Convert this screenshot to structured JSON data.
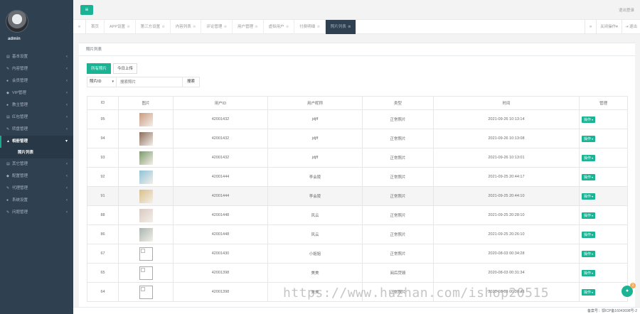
{
  "sidebar": {
    "username": "admin",
    "items": [
      {
        "icon": "▤",
        "label": "基本设置",
        "active": false
      },
      {
        "icon": "✎",
        "label": "内容管理",
        "active": false
      },
      {
        "icon": "●",
        "label": "会员管理",
        "active": false
      },
      {
        "icon": "◆",
        "label": "VIP管理",
        "active": false
      },
      {
        "icon": "●",
        "label": "教主管理",
        "active": false
      },
      {
        "icon": "▤",
        "label": "红包管理",
        "active": false
      },
      {
        "icon": "✎",
        "label": "转盘管理",
        "active": false
      },
      {
        "icon": "▲",
        "label": "相册管理",
        "active": true
      }
    ],
    "submenu_label": "照片列表",
    "items_after": [
      {
        "icon": "▤",
        "label": "其它管理"
      },
      {
        "icon": "◆",
        "label": "配置管理"
      },
      {
        "icon": "✎",
        "label": "代理管理"
      },
      {
        "icon": "●",
        "label": "系统设置"
      },
      {
        "icon": "✎",
        "label": "问题管理"
      }
    ]
  },
  "topbar": {
    "menu_icon": "≡",
    "right_text": "退出登录"
  },
  "tabs": {
    "items": [
      {
        "label": "首页",
        "closable": false,
        "active": false
      },
      {
        "label": "APP设置",
        "closable": true,
        "active": false
      },
      {
        "label": "第三方设置",
        "closable": true,
        "active": false
      },
      {
        "label": "内容列表",
        "closable": true,
        "active": false
      },
      {
        "label": "评论管理",
        "closable": true,
        "active": false
      },
      {
        "label": "用户管理",
        "closable": true,
        "active": false
      },
      {
        "label": "虚拟用户",
        "closable": true,
        "active": false
      },
      {
        "label": "付费明细",
        "closable": true,
        "active": false
      },
      {
        "label": "照片列表",
        "closable": true,
        "active": true
      }
    ],
    "close_ops": "关闭操作",
    "exit": "退出"
  },
  "panel": {
    "title": "照片列表",
    "filter_all": "所有照片",
    "filter_today": "今日上传",
    "select_value": "照片ID",
    "search_placeholder": "搜索照片",
    "search_button": "搜索"
  },
  "table": {
    "headers": [
      "ID",
      "图片",
      "用户ID",
      "用户昵称",
      "类型",
      "时间",
      "管理"
    ],
    "op_label": "操作",
    "rows": [
      {
        "id": "95",
        "thumb": "#c99a7e",
        "user_id": "42001432",
        "nickname": "jdjff",
        "type": "正常照片",
        "time": "2021-09-26 10:13:14"
      },
      {
        "id": "94",
        "thumb": "#8a6c5a",
        "user_id": "42001432",
        "nickname": "jdjff",
        "type": "正常照片",
        "time": "2021-09-26 10:13:08"
      },
      {
        "id": "93",
        "thumb": "#7a9a6a",
        "user_id": "42001432",
        "nickname": "jdjff",
        "type": "正常照片",
        "time": "2021-09-26 10:13:01"
      },
      {
        "id": "92",
        "thumb": "#8ec3d8",
        "user_id": "42001444",
        "nickname": "李会陵",
        "type": "正常照片",
        "time": "2021-09-25 20:44:17"
      },
      {
        "id": "91",
        "thumb": "#d8c08a",
        "user_id": "42001444",
        "nickname": "李会陵",
        "type": "正常照片",
        "time": "2021-09-25 20:44:10",
        "highlight": true
      },
      {
        "id": "88",
        "thumb": "#d9c9c2",
        "user_id": "42001448",
        "nickname": "风云",
        "type": "正常照片",
        "time": "2021-09-25 20:28:10"
      },
      {
        "id": "86",
        "thumb": "#a9b6ae",
        "user_id": "42001448",
        "nickname": "风云",
        "type": "正常照片",
        "time": "2021-09-25 20:26:10"
      },
      {
        "id": "67",
        "thumb": "",
        "user_id": "42001430",
        "nickname": "小姐姐",
        "type": "正常照片",
        "time": "2020-08-03 00:34:28",
        "nickname_left": true
      },
      {
        "id": "65",
        "thumb": "",
        "user_id": "42001398",
        "nickname": "美美",
        "type": "阅后焚毁",
        "time": "2020-08-03 00:31:34"
      },
      {
        "id": "64",
        "thumb": "",
        "user_id": "42001398",
        "nickname": "美美",
        "type": "正常照片",
        "time": "2020-08-03 00:30:45"
      }
    ]
  },
  "footer": {
    "text": "备案号：鄂ICP备16043698号-2"
  },
  "watermark": "https://www.huzhan.com/ishop20515",
  "chat": {
    "icon": "●",
    "badge": "1"
  },
  "colors": {
    "accent": "#1ab394",
    "sidebar": "#2f4050"
  }
}
